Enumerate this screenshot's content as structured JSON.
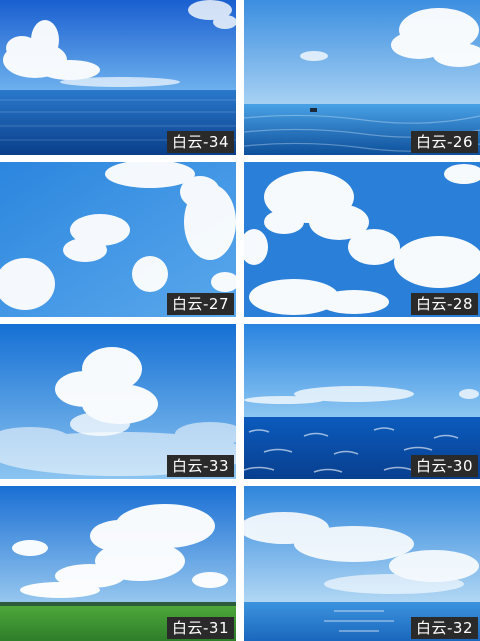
{
  "tiles": [
    {
      "label": "白云-34"
    },
    {
      "label": "白云-26"
    },
    {
      "label": "白云-27"
    },
    {
      "label": "白云-28"
    },
    {
      "label": "白云-33"
    },
    {
      "label": "白云-30"
    },
    {
      "label": "白云-31"
    },
    {
      "label": "白云-32"
    }
  ],
  "colors": {
    "sky_deep": "#1f6fd6",
    "sky_light": "#8ec3f0",
    "sea_dark": "#0e4fa0",
    "sea_mid": "#1c74c8",
    "grass": "#3f9a3a",
    "caption_bg": "#2a2a2a"
  }
}
